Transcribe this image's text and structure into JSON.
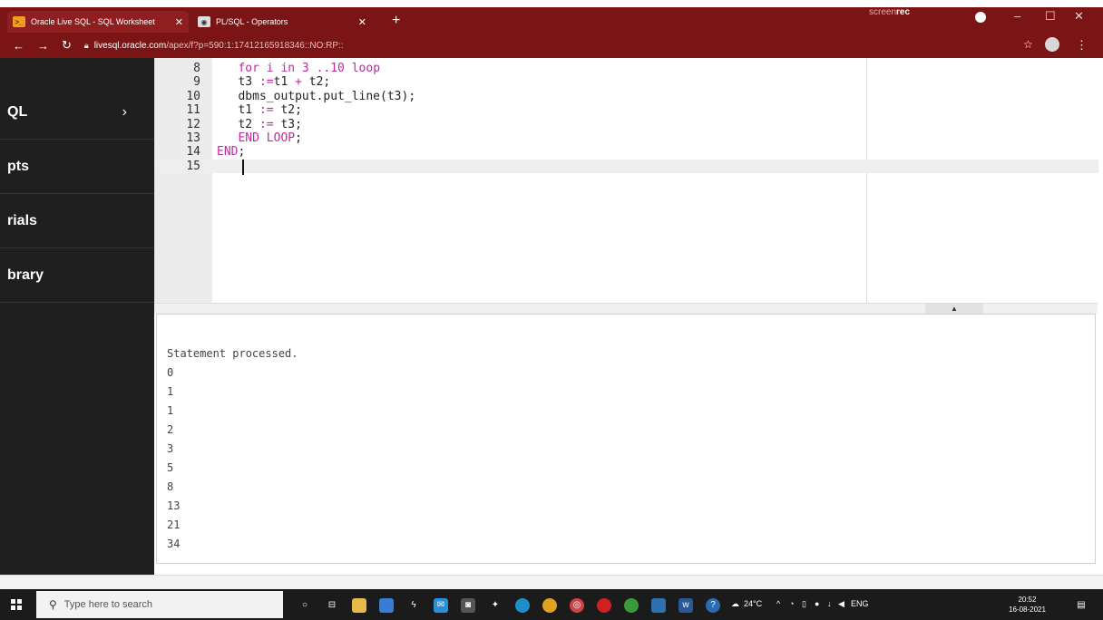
{
  "browser": {
    "tabs": [
      {
        "title": "Oracle Live SQL - SQL Worksheet",
        "icon": "oracle-sql-icon",
        "close": "✕"
      },
      {
        "title": "PL/SQL - Operators",
        "icon": "tutorial-site-icon",
        "close": "✕"
      }
    ],
    "new_tab": "+",
    "recorder": {
      "prefix": "screen",
      "suffix": "rec"
    },
    "url_host": "livesql.oracle.com",
    "url_path": "/apex/f?p=590:1:17412165918346::NO:RP::",
    "window_controls": {
      "minimize": "–",
      "maximize": "☐",
      "close": "✕"
    }
  },
  "sidebar": {
    "items": [
      {
        "label": "QL",
        "chevron": "›"
      },
      {
        "label": "pts"
      },
      {
        "label": "rials"
      },
      {
        "label": "brary"
      }
    ]
  },
  "editor": {
    "lines": [
      {
        "n": "8",
        "parts": [
          {
            "t": "   "
          },
          {
            "t": "for i in 3 ..10 loop",
            "kw": true
          }
        ]
      },
      {
        "n": "9",
        "parts": [
          {
            "t": "   t3 "
          },
          {
            "t": ":=",
            "kw": true
          },
          {
            "t": "t1 "
          },
          {
            "t": "+",
            "kw": true
          },
          {
            "t": " t2;"
          }
        ]
      },
      {
        "n": "10",
        "parts": [
          {
            "t": "   dbms_output.put_line(t3);"
          }
        ]
      },
      {
        "n": "11",
        "parts": [
          {
            "t": "   t1 "
          },
          {
            "t": ":=",
            "kw": true
          },
          {
            "t": " t2;"
          }
        ]
      },
      {
        "n": "12",
        "parts": [
          {
            "t": "   t2 "
          },
          {
            "t": ":=",
            "kw": true
          },
          {
            "t": " t3;"
          }
        ]
      },
      {
        "n": "13",
        "parts": [
          {
            "t": "   "
          },
          {
            "t": "END LOOP",
            "kw": true
          },
          {
            "t": ";"
          }
        ]
      },
      {
        "n": "14",
        "parts": [
          {
            "t": "END",
            "kw": true
          },
          {
            "t": ";"
          }
        ]
      },
      {
        "n": "15",
        "parts": []
      }
    ]
  },
  "output": {
    "lines": [
      "Statement processed.",
      "0",
      "1",
      "1",
      "2",
      "3",
      "5",
      "8",
      "13",
      "21",
      "34"
    ]
  },
  "taskbar": {
    "search_placeholder": "Type here to search",
    "weather": "24°C",
    "language": "ENG",
    "time": "20:52",
    "date": "16-08-2021"
  }
}
